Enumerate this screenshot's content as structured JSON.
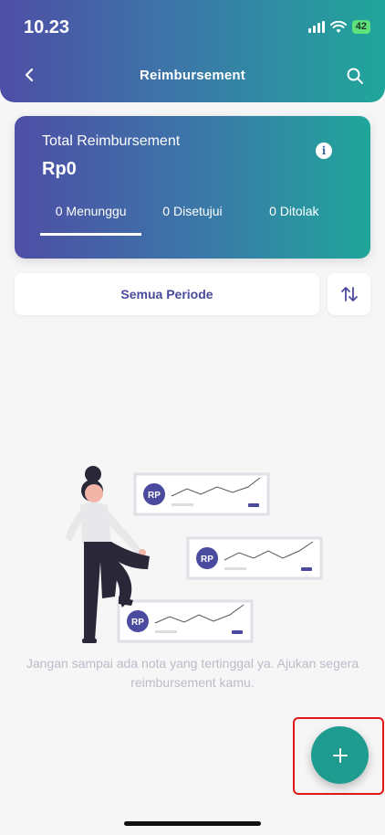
{
  "status_bar": {
    "time": "10.23",
    "battery": "42"
  },
  "header": {
    "title": "Reimbursement",
    "back_icon": "chevron-left-icon",
    "search_icon": "search-icon"
  },
  "summary": {
    "label": "Total Reimbursement",
    "amount": "Rp0",
    "info_icon": "info-icon",
    "tabs": [
      {
        "label": "0 Menunggu",
        "active": true
      },
      {
        "label": "0 Disetujui",
        "active": false
      },
      {
        "label": "0 Ditolak",
        "active": false
      }
    ]
  },
  "filter": {
    "period_label": "Semua Periode",
    "sort_icon": "sort-arrows-icon"
  },
  "empty_state": {
    "card_logo": "RP",
    "message": "Jangan sampai ada nota yang tertinggal ya. Ajukan segera reimbursement kamu."
  },
  "fab": {
    "icon": "plus-icon"
  },
  "colors": {
    "primary": "#4a4a9e",
    "accent": "#1f9c90",
    "background": "#f6f6f7"
  }
}
